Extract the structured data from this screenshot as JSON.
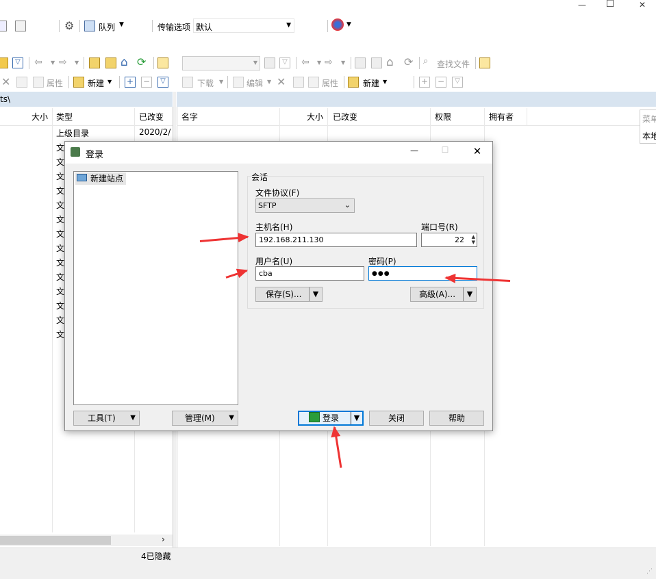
{
  "window": {
    "minimize": "—",
    "maximize": "☐",
    "close": "✕"
  },
  "toolbar1": {
    "queue_label": "队列",
    "transfer_options_label": "传输选项",
    "transfer_default": "默认"
  },
  "local_toolbar": {
    "delete_label": "",
    "properties_label": "属性",
    "new_label": "新建"
  },
  "remote_toolbar": {
    "download_label": "下载",
    "edit_label": "编辑",
    "properties_label": "属性",
    "new_label": "新建",
    "find_files_label": "查找文件"
  },
  "local_path": "ts\\",
  "local_columns": {
    "size": "大小",
    "type": "类型",
    "changed": "已改变"
  },
  "local_rows": [
    {
      "type": "上级目录",
      "changed": "2020/2/"
    },
    {
      "type": "文"
    },
    {
      "type": "文"
    },
    {
      "type": "文"
    },
    {
      "type": "文"
    },
    {
      "type": "文"
    },
    {
      "type": "文"
    },
    {
      "type": "文"
    },
    {
      "type": "文"
    },
    {
      "type": "文"
    },
    {
      "type": "文"
    },
    {
      "type": "文"
    },
    {
      "type": "文"
    },
    {
      "type": "文"
    },
    {
      "type": "文"
    }
  ],
  "remote_columns": {
    "name": "名字",
    "size": "大小",
    "changed": "已改变",
    "rights": "权限",
    "owner": "拥有者"
  },
  "popup_menu": {
    "item1": "菜单",
    "item2": "本地"
  },
  "status": {
    "hidden": "4已隐藏"
  },
  "dialog": {
    "title": "登录",
    "site_tree": {
      "new_site": "新建站点"
    },
    "session_group": "会话",
    "protocol_label": "文件协议(F)",
    "protocol_value": "SFTP",
    "host_label": "主机名(H)",
    "host_value": "192.168.211.130",
    "port_label": "端口号(R)",
    "port_value": "22",
    "user_label": "用户名(U)",
    "user_value": "cba",
    "password_label": "密码(P)",
    "password_value": "●●●",
    "save_button": "保存(S)...",
    "advanced_button": "高级(A)...",
    "tools_button": "工具(T)",
    "manage_button": "管理(M)",
    "login_button": "登录",
    "close_button": "关闭",
    "help_button": "帮助"
  },
  "colors": {
    "accent": "#0078d7",
    "annotation": "#e33333",
    "panel_header": "#d8e4f0"
  }
}
